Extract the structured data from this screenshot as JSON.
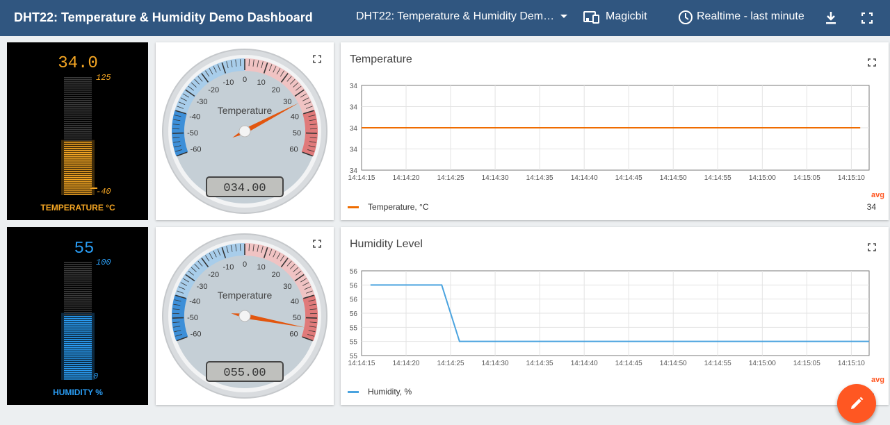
{
  "header": {
    "title": "DHT22: Temperature & Humidity Demo Dashboard",
    "dashboard_select": "DHT22: Temperature & Humidity Dem…",
    "customer": "Magicbit",
    "timewindow": "Realtime - last minute"
  },
  "thermometer_temp": {
    "display": "34.0",
    "max": "125",
    "min": "-40",
    "label": "TEMPERATURE °C",
    "value": 34,
    "range": [
      -40,
      125
    ],
    "color": "#f5a623"
  },
  "thermometer_hum": {
    "display": "55",
    "max": "100",
    "min": "0",
    "label": "HUMIDITY %",
    "value": 55,
    "range": [
      0,
      100
    ],
    "color": "#2a9df4"
  },
  "gauge_temp": {
    "title": "Temperature",
    "lcd": "034.00",
    "value": 34,
    "ticks": [
      "-60",
      "-50",
      "-40",
      "-30",
      "-20",
      "-10",
      "0",
      "10",
      "20",
      "30",
      "40",
      "50",
      "60"
    ],
    "min": -60,
    "max": 60
  },
  "gauge_hum": {
    "title": "Temperature",
    "lcd": "055.00",
    "value": 55,
    "ticks": [
      "-60",
      "-50",
      "-40",
      "-30",
      "-20",
      "-10",
      "0",
      "10",
      "20",
      "30",
      "40",
      "50",
      "60"
    ],
    "min": -60,
    "max": 60
  },
  "chart_data": [
    {
      "type": "line",
      "title": "Temperature",
      "x": [
        "14:14:15",
        "14:14:20",
        "14:14:25",
        "14:14:30",
        "14:14:35",
        "14:14:40",
        "14:14:45",
        "14:14:50",
        "14:14:55",
        "14:15:00",
        "14:15:05",
        "14:15:10"
      ],
      "y_ticks": [
        "34",
        "34",
        "34",
        "34",
        "34"
      ],
      "ylim": [
        33.6,
        34.4
      ],
      "series": [
        {
          "name": "Temperature, °C",
          "color": "#ef6c00",
          "points": [
            [
              "14:14:15",
              34
            ],
            [
              "14:15:11",
              34
            ]
          ]
        }
      ],
      "aggregate_label": "avg",
      "aggregate_value": "34"
    },
    {
      "type": "line",
      "title": "Humidity Level",
      "x": [
        "14:14:15",
        "14:14:20",
        "14:14:25",
        "14:14:30",
        "14:14:35",
        "14:14:40",
        "14:14:45",
        "14:14:50",
        "14:14:55",
        "14:15:00",
        "14:15:05",
        "14:15:10"
      ],
      "y_ticks": [
        "56",
        "56",
        "56",
        "56",
        "55",
        "55",
        "55"
      ],
      "ylim": [
        54.9,
        56.1
      ],
      "series": [
        {
          "name": "Humidity, %",
          "color": "#4aa3df",
          "points": [
            [
              "14:14:16",
              55.9
            ],
            [
              "14:14:24",
              55.9
            ],
            [
              "14:14:26",
              55.1
            ],
            [
              "14:15:12",
              55.1
            ]
          ]
        }
      ],
      "aggregate_label": "avg",
      "aggregate_value": "..."
    }
  ]
}
